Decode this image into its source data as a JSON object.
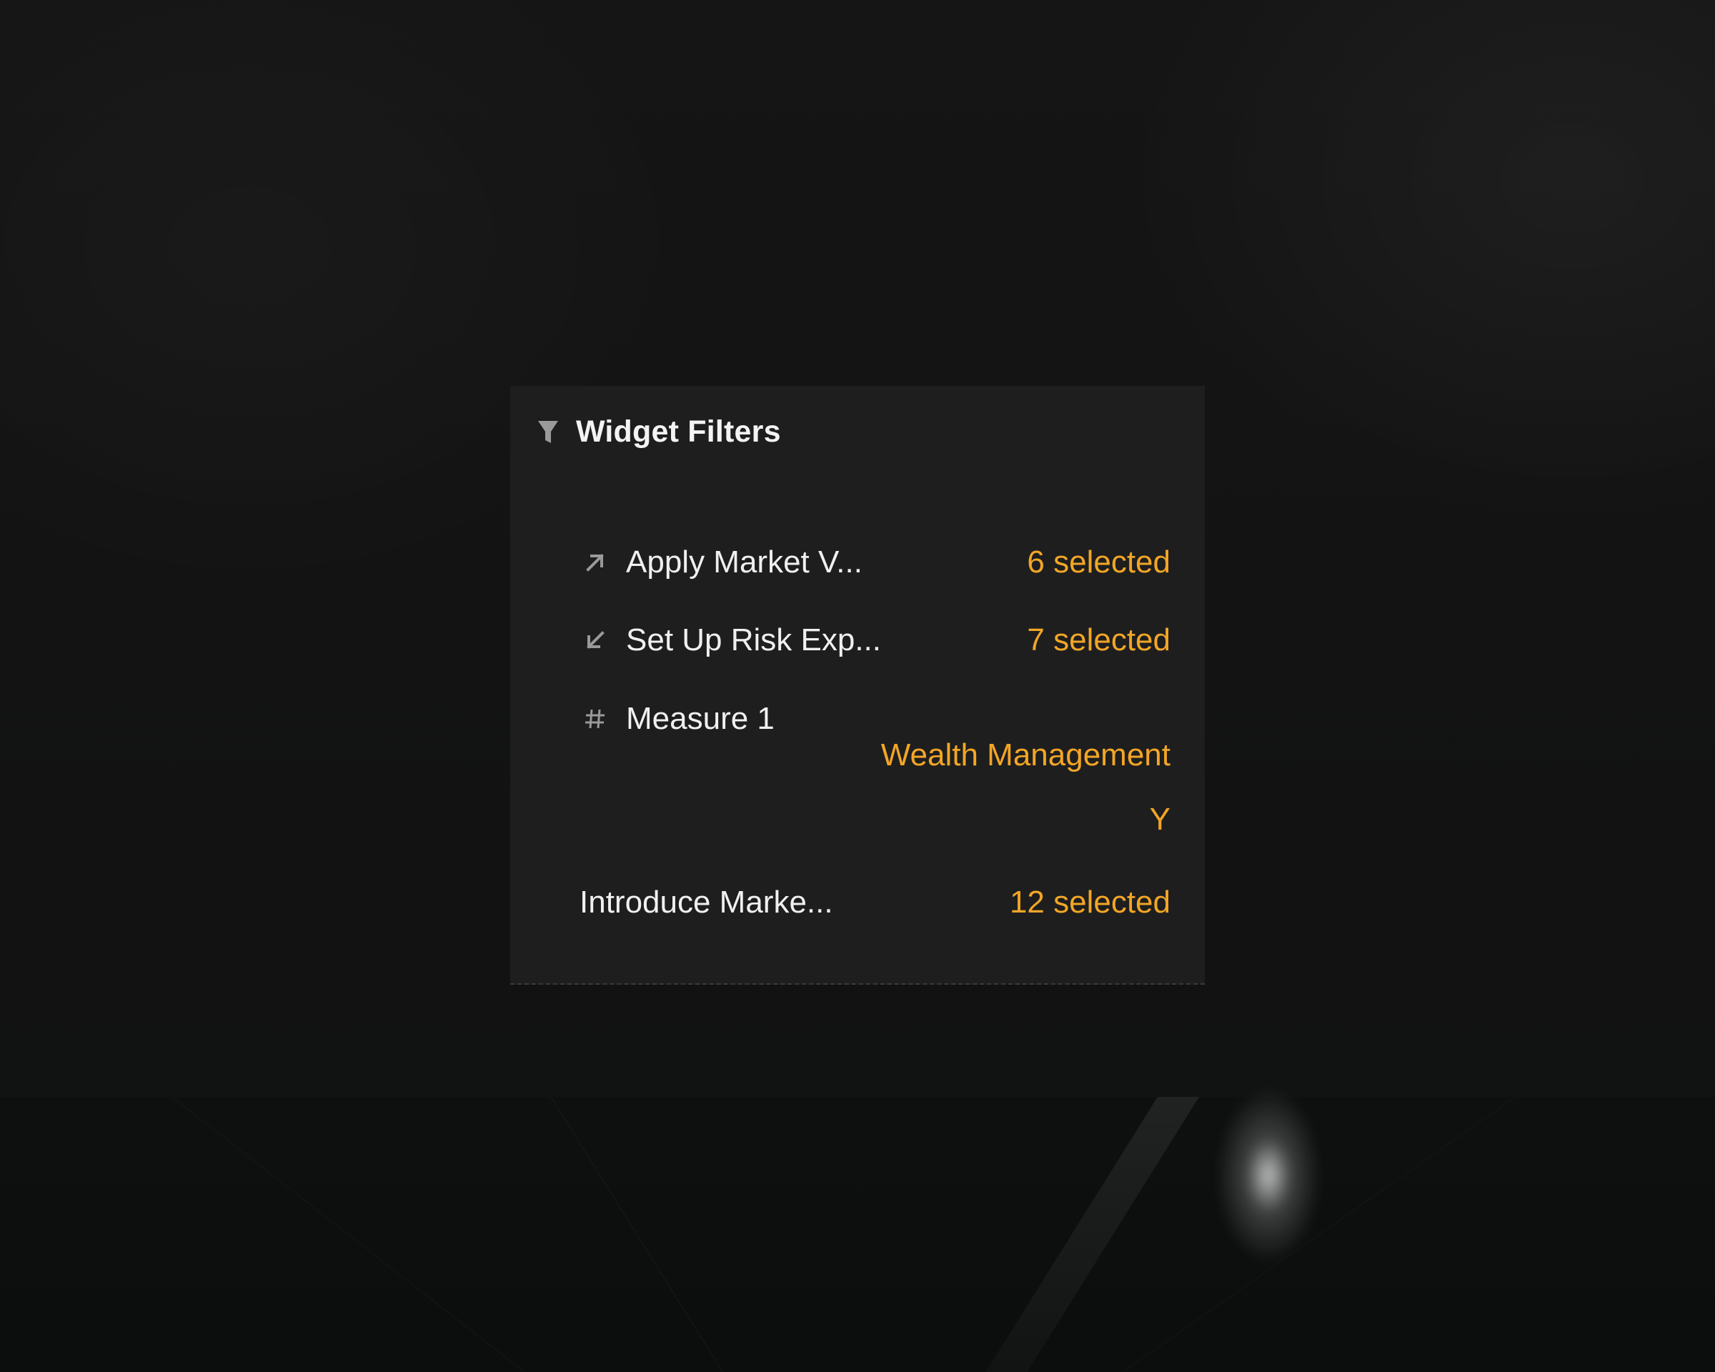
{
  "widget": {
    "title": "Widget Filters",
    "header_icon": "filter-icon"
  },
  "filters": [
    {
      "icon": "arrow-up-right-icon",
      "label": "Apply Market V...",
      "value": "6 selected"
    },
    {
      "icon": "arrow-down-left-icon",
      "label": "Set Up Risk Exp...",
      "value": "7 selected"
    },
    {
      "icon": "hash-icon",
      "label": "Measure 1",
      "values": [
        "Wealth Management",
        "Y"
      ]
    },
    {
      "label": "Introduce Marke...",
      "value": "12 selected"
    }
  ],
  "colors": {
    "accent": "#f2a626",
    "panel": "#1e1e1f",
    "text": "#f0f0f0"
  }
}
